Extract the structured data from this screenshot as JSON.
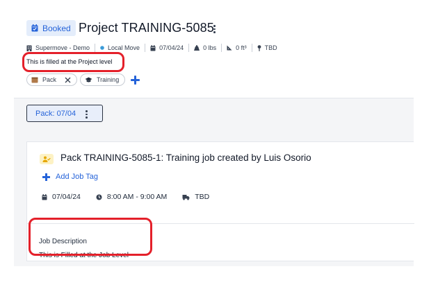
{
  "project": {
    "status": "Booked",
    "title": "Project TRAINING-5085",
    "meta": {
      "organization": "Supermove - Demo",
      "move_type": "Local Move",
      "date": "07/04/24",
      "weight": "0 lbs",
      "volume": "0 ft³",
      "location": "TBD"
    },
    "description": "This is filled at the Project level",
    "tags": [
      "Pack",
      "Training"
    ]
  },
  "job_tab": {
    "label": "Pack: 07/04"
  },
  "job": {
    "title": "Pack TRAINING-5085-1: Training job created by Luis Osorio",
    "add_tag_label": "Add Job Tag",
    "date": "07/04/24",
    "time": "8:00 AM - 9:00 AM",
    "location": "TBD",
    "description_heading": "Job Description",
    "description": "This is Filled at the Job Level"
  },
  "colors": {
    "accent": "#2563d9",
    "badge_bg": "#e4edfb",
    "highlight": "#e4202a",
    "move_type_dot": "#3b9bd8"
  },
  "icons": {
    "status": "calendar-check-icon",
    "organization": "building-icon",
    "move_type": "dot-icon",
    "date": "calendar-icon",
    "weight": "weight-icon",
    "volume": "ruler-triangle-icon",
    "location": "map-pin-icon",
    "tag_pack": "box-icon",
    "tag_training": "graduation-cap-icon",
    "tag_remove": "close-icon",
    "add_tag": "plus-icon",
    "job_type": "user-check-icon",
    "job_date": "calendar-icon",
    "job_time": "clock-icon",
    "job_location": "truck-icon"
  }
}
